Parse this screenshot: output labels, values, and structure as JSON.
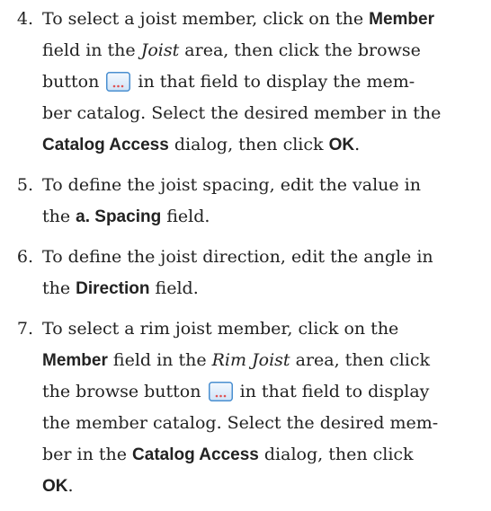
{
  "steps": [
    {
      "number": "4.",
      "lines": [
        [
          "To select a joist member, click on the ",
          "Member"
        ],
        [
          "field in the ",
          "Joist",
          " area, then click the browse"
        ],
        [
          "button ",
          " in that field to display the mem-"
        ],
        [
          "ber catalog. Select the desired member in the"
        ],
        [
          "Catalog Access",
          " dialog, then click ",
          "OK",
          "."
        ]
      ]
    },
    {
      "number": "5.",
      "lines": [
        [
          "To define the joist spacing, edit the value in"
        ],
        [
          "the ",
          "a. Spacing",
          " field."
        ]
      ]
    },
    {
      "number": "6.",
      "lines": [
        [
          "To define the joist direction, edit the angle in"
        ],
        [
          "the ",
          "Direction",
          " field."
        ]
      ]
    },
    {
      "number": "7.",
      "lines": [
        [
          "To select a rim joist member, click on the"
        ],
        [
          "Member",
          " field in the ",
          "Rim Joist",
          " area, then click"
        ],
        [
          "the browse button ",
          " in that field to display"
        ],
        [
          "the member catalog. Select the desired mem-"
        ],
        [
          "ber in the ",
          "Catalog Access",
          " dialog, then click"
        ],
        [
          "OK",
          "."
        ]
      ]
    }
  ],
  "icons": {
    "browse": "browse-button-icon",
    "browse_glyph": "..."
  },
  "colors": {
    "text": "#222222",
    "browse_border": "#4a8fd0",
    "browse_fill_top": "#f4f9ff",
    "browse_fill_bottom": "#cfe3f7",
    "browse_dots": "#e05050"
  }
}
